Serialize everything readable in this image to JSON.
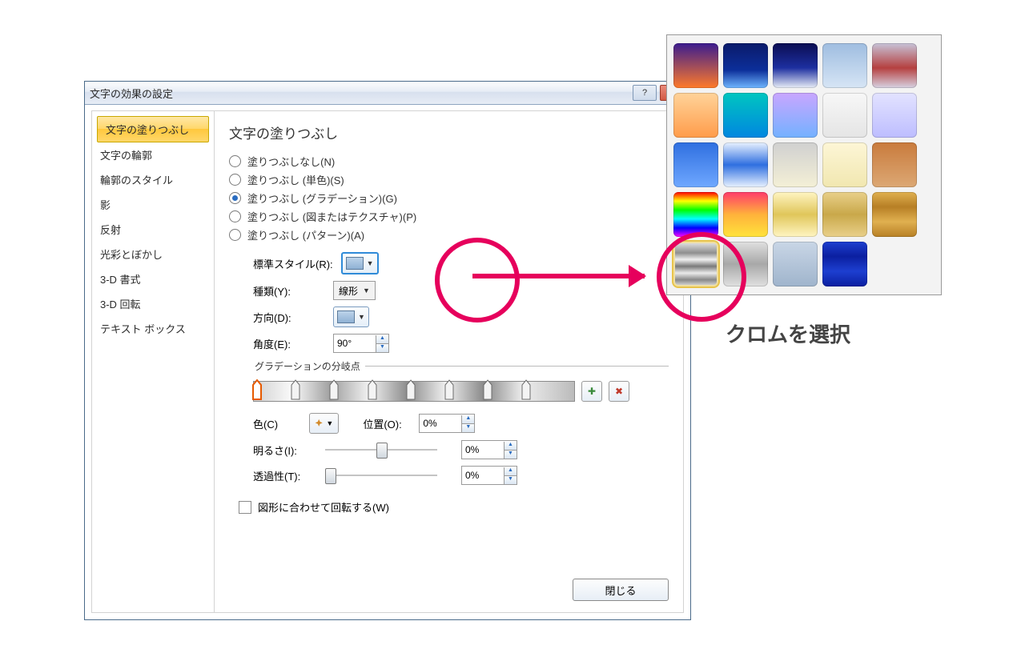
{
  "dialog": {
    "title": "文字の効果の設定",
    "help_symbol": "?",
    "close_symbol": "×"
  },
  "sidebar": {
    "items": [
      {
        "label": "文字の塗りつぶし",
        "selected": true
      },
      {
        "label": "文字の輪郭"
      },
      {
        "label": "輪郭のスタイル"
      },
      {
        "label": "影"
      },
      {
        "label": "反射"
      },
      {
        "label": "光彩とぼかし"
      },
      {
        "label": "3-D 書式"
      },
      {
        "label": "3-D 回転"
      },
      {
        "label": "テキスト ボックス"
      }
    ]
  },
  "panel": {
    "heading": "文字の塗りつぶし",
    "radios": [
      {
        "label": "塗りつぶしなし(N)"
      },
      {
        "label": "塗りつぶし (単色)(S)"
      },
      {
        "label": "塗りつぶし (グラデーション)(G)",
        "selected": true
      },
      {
        "label": "塗りつぶし (図またはテクスチャ)(P)"
      },
      {
        "label": "塗りつぶし (パターン)(A)"
      }
    ],
    "preset_label": "標準スタイル(R):",
    "type_label": "種類(Y):",
    "type_value": "線形",
    "direction_label": "方向(D):",
    "angle_label": "角度(E):",
    "angle_value": "90°",
    "stops_legend": "グラデーションの分岐点",
    "color_label": "色(C)",
    "position_label": "位置(O):",
    "position_value": "0%",
    "brightness_label": "明るさ(I):",
    "brightness_value": "0%",
    "transparency_label": "透過性(T):",
    "transparency_value": "0%",
    "rotate_with_shape_label": "図形に合わせて回転する(W)",
    "close_button": "閉じる",
    "stop_positions_pct": [
      0,
      12,
      24,
      36,
      48,
      60,
      72,
      84
    ]
  },
  "flyout": {
    "presets": [
      {
        "bg": "linear-gradient(#3b1c8f,#ff7a2a)"
      },
      {
        "bg": "linear-gradient(#0b1a6a,#0c2f9a 60%,#6fb6ff)"
      },
      {
        "bg": "linear-gradient(#0b0d52,#1d2fa0 55%,#e9eef7)"
      },
      {
        "bg": "linear-gradient(#9fbde0,#d6e5f5)"
      },
      {
        "bg": "linear-gradient(#c7c3d8,#b54040 55%,#d7d3e3)"
      },
      {
        "bg": "linear-gradient(#ffd39a,#ff9c4a)"
      },
      {
        "bg": "linear-gradient(#00c6c0,#0086e0)"
      },
      {
        "bg": "linear-gradient(#c9a6ff,#73b1ff)"
      },
      {
        "bg": "linear-gradient(#f7f7f7,#e5e5e5)"
      },
      {
        "bg": "linear-gradient(#e3e3ff,#bdbdff)"
      },
      {
        "bg": "linear-gradient(#2f6fe0,#6fa8ff)"
      },
      {
        "bg": "linear-gradient(#e9f2ff,#2f6fe0 50%,#e9f2ff)"
      },
      {
        "bg": "linear-gradient(#d0d0d0,#f4f0d6)"
      },
      {
        "bg": "linear-gradient(#fdf6d6,#f1e7b0)"
      },
      {
        "bg": "linear-gradient(#c97b3d,#dca874)"
      },
      {
        "bg": "linear-gradient(#ff0000,#ffff00 20%,#00ff00 40%,#00ffff 60%,#0000ff 80%,#ff00ff)"
      },
      {
        "bg": "linear-gradient(#ff3b6b,#ffb23b 50%,#ffe33b)"
      },
      {
        "bg": "linear-gradient(#fff5c2,#e0c65a 50%,#fff5c2)"
      },
      {
        "bg": "linear-gradient(#e9d08a,#c9a84a 50%,#e9d08a)"
      },
      {
        "bg": "linear-gradient(#e0b050,#b77f25 33%,#e0b050 66%,#b77f25)"
      },
      {
        "bg": "linear-gradient(#e8e8e8,#8f8f8f 25%,#f0f0f0 40%,#7a7a7a 55%,#eaeaea 70%,#888 85%,#e5e5e5)",
        "selected": true
      },
      {
        "bg": "linear-gradient(#e0e0e0,#a8a8a8 50%,#e0e0e0)"
      },
      {
        "bg": "linear-gradient(#c9d6e6,#9fb4cc)"
      },
      {
        "bg": "linear-gradient(#1d3fd0,#0b1fa0 33%,#1d3fd0 66%,#0b1fa0)"
      }
    ]
  },
  "annotation": {
    "text": "クロムを選択"
  }
}
